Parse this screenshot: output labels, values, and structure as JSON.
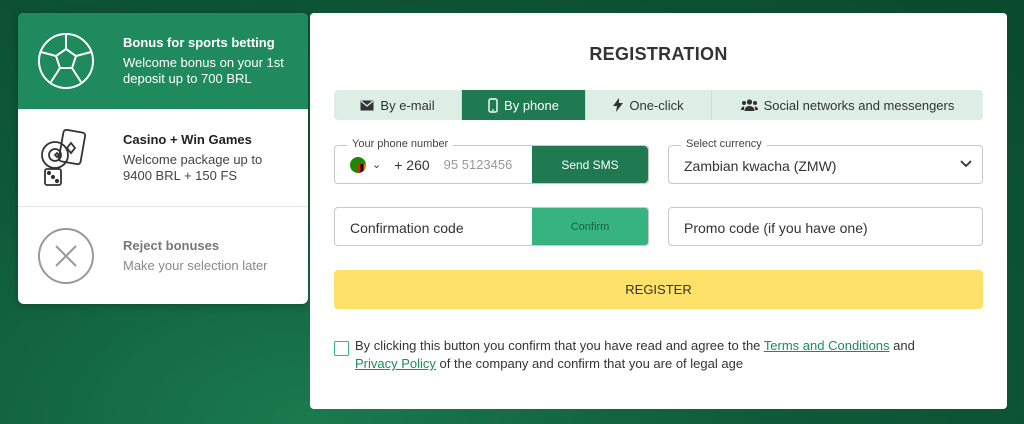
{
  "bonuses": [
    {
      "title": "Bonus for sports betting",
      "desc": "Welcome bonus on your 1st deposit up to 700 BRL",
      "icon": "soccer-ball-icon"
    },
    {
      "title": "Casino + Win Games",
      "desc": "Welcome package up to 9400 BRL + 150 FS",
      "icon": "casino-cards-icon"
    },
    {
      "title": "Reject bonuses",
      "desc": "Make your selection later",
      "icon": "close-circle-icon"
    }
  ],
  "registration": {
    "title": "REGISTRATION",
    "tabs": [
      {
        "label": "By e-mail",
        "icon": "envelope-icon"
      },
      {
        "label": "By phone",
        "icon": "phone-icon"
      },
      {
        "label": "One-click",
        "icon": "lightning-icon"
      },
      {
        "label": "Social networks and messengers",
        "icon": "users-icon"
      }
    ],
    "phone": {
      "label": "Your phone number",
      "dial_code": "+ 260",
      "placeholder": "95 5123456",
      "send_button": "Send SMS"
    },
    "currency": {
      "label": "Select currency",
      "value": "Zambian kwacha (ZMW)"
    },
    "confirmation": {
      "placeholder": "Confirmation code",
      "confirm_button": "Confirm"
    },
    "promo": {
      "placeholder": "Promo code (if you have one)"
    },
    "register_button": "REGISTER",
    "agreement": {
      "text1": "By clicking this button you confirm that you have read and agree to the ",
      "terms_link": "Terms and Conditions",
      "text2": " and ",
      "privacy_link": "Privacy Policy",
      "text3": " of the company and confirm that you are of legal age"
    }
  },
  "colors": {
    "accent": "#1f7a52",
    "register": "#fde168",
    "background": "#0f5a3a"
  }
}
